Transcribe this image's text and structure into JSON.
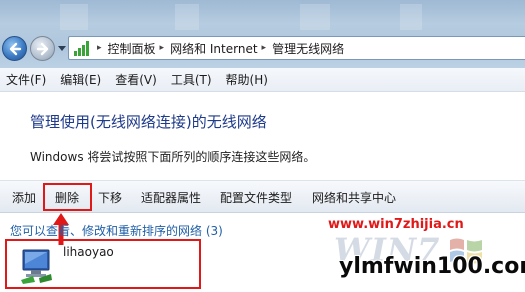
{
  "address": {
    "breadcrumbs": [
      "控制面板",
      "网络和 Internet",
      "管理无线网络"
    ],
    "separator": "▸"
  },
  "menubar": {
    "items": [
      "文件(F)",
      "编辑(E)",
      "查看(V)",
      "工具(T)",
      "帮助(H)"
    ]
  },
  "page": {
    "title": "管理使用(无线网络连接)的无线网络",
    "description": "Windows 将尝试按照下面所列的顺序连接这些网络。"
  },
  "toolbar": {
    "add": "添加",
    "delete": "删除",
    "move_down": "下移",
    "adapter_properties": "适配器属性",
    "profile_types": "配置文件类型",
    "network_sharing_center": "网络和共享中心"
  },
  "list": {
    "hint": "您可以查看、修改和重新排序的网络 (3)",
    "networks": [
      {
        "name": "lihaoyao"
      }
    ]
  },
  "watermarks": {
    "url": "www.win7zhijia.cn",
    "logo_text": "WIN7",
    "site": "ylmfwin100.com"
  },
  "colors": {
    "highlight_red": "#e01818",
    "title_blue": "#1e3a8a",
    "link_blue": "#1f5fa8"
  }
}
